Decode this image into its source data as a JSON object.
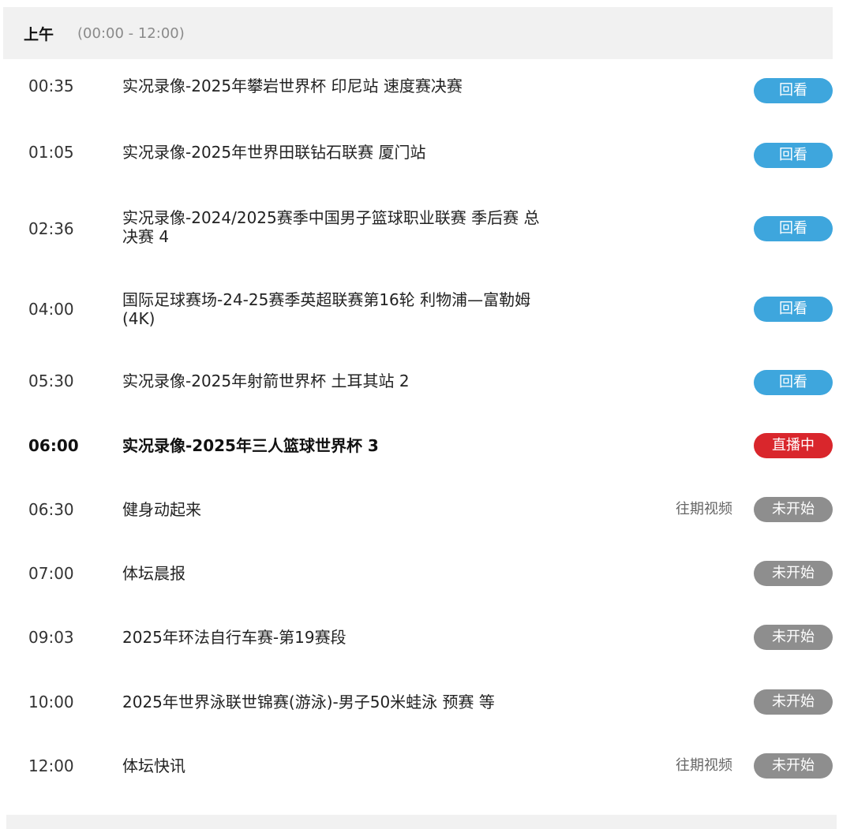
{
  "section": {
    "title": "上午",
    "range": "(00:00 - 12:00)"
  },
  "programs": [
    {
      "time": "00:35",
      "title": "实况录像-2025年攀岩世界杯 印尼站 速度赛决赛",
      "status": "回看",
      "kind": "replay",
      "past": ""
    },
    {
      "time": "01:05",
      "title": "实况录像-2025年世界田联钻石联赛 厦门站",
      "status": "回看",
      "kind": "replay",
      "past": ""
    },
    {
      "time": "02:36",
      "title": "实况录像-2024/2025赛季中国男子篮球职业联赛 季后赛 总决赛 4",
      "status": "回看",
      "kind": "replay",
      "past": ""
    },
    {
      "time": "04:00",
      "title": "国际足球赛场-24-25赛季英超联赛第16轮 利物浦—富勒姆(4K)",
      "status": "回看",
      "kind": "replay",
      "past": ""
    },
    {
      "time": "05:30",
      "title": "实况录像-2025年射箭世界杯 土耳其站 2",
      "status": "回看",
      "kind": "replay",
      "past": ""
    },
    {
      "time": "06:00",
      "title": "实况录像-2025年三人篮球世界杯 3",
      "status": "直播中",
      "kind": "live",
      "past": ""
    },
    {
      "time": "06:30",
      "title": "健身动起来",
      "status": "未开始",
      "kind": "upcoming",
      "past": "往期视频"
    },
    {
      "time": "07:00",
      "title": "体坛晨报",
      "status": "未开始",
      "kind": "upcoming",
      "past": ""
    },
    {
      "time": "09:03",
      "title": "2025年环法自行车赛-第19赛段",
      "status": "未开始",
      "kind": "upcoming",
      "past": ""
    },
    {
      "time": "10:00",
      "title": "2025年世界泳联世锦赛(游泳)-男子50米蛙泳 预赛 等",
      "status": "未开始",
      "kind": "upcoming",
      "past": ""
    },
    {
      "time": "12:00",
      "title": "体坛快讯",
      "status": "未开始",
      "kind": "upcoming",
      "past": "往期视频"
    }
  ],
  "colors": {
    "replay": "#3ea6dd",
    "live": "#d9262c",
    "upcoming": "#8e8e8e"
  }
}
